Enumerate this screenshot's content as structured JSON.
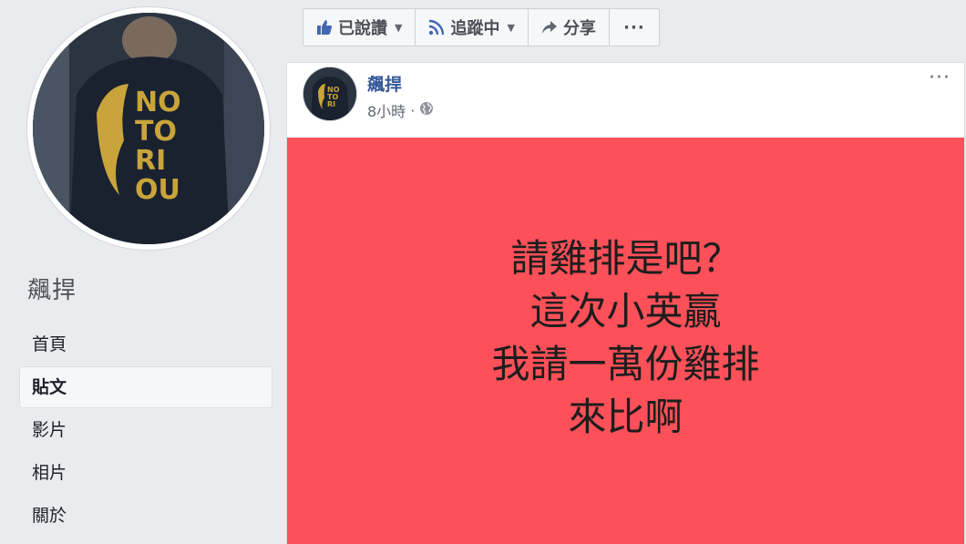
{
  "sidebar": {
    "page_name": "飆捍",
    "nav": [
      {
        "label": "首頁",
        "active": false
      },
      {
        "label": "貼文",
        "active": true
      },
      {
        "label": "影片",
        "active": false
      },
      {
        "label": "相片",
        "active": false
      },
      {
        "label": "關於",
        "active": false
      }
    ]
  },
  "actions": {
    "liked": {
      "label": "已說讚",
      "icon": "thumbs-up-icon"
    },
    "following": {
      "label": "追蹤中",
      "icon": "rss-icon"
    },
    "share": {
      "label": "分享",
      "icon": "share-arrow-icon"
    },
    "more": {
      "label": "···"
    }
  },
  "post": {
    "author": "飆捍",
    "time": "8小時",
    "separator": "·",
    "privacy_icon": "globe-icon",
    "menu": "···",
    "banner_color": "#fd5059",
    "text_lines": [
      "請雞排是吧？",
      "這次小英贏",
      "我請一萬份雞排",
      "來比啊"
    ]
  },
  "colors": {
    "link": "#365899",
    "background": "#e9ebee"
  }
}
